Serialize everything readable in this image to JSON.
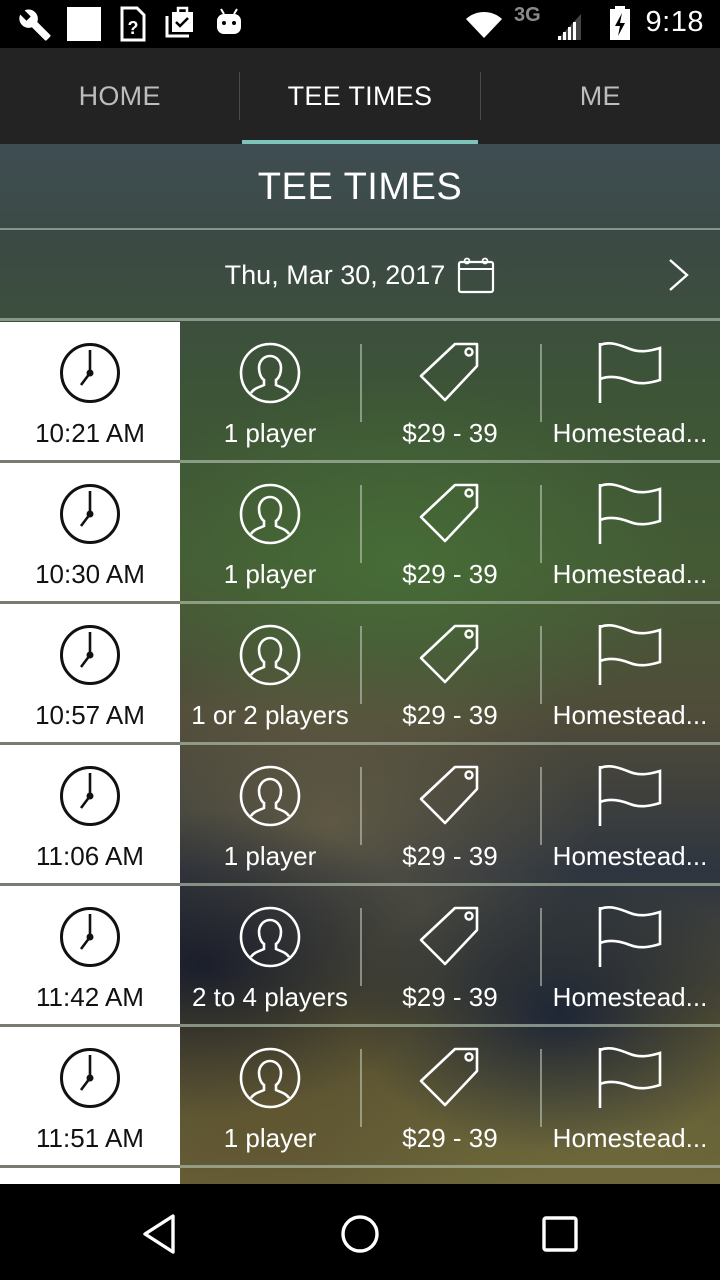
{
  "status_bar": {
    "left_icons": [
      "wrench-icon",
      "blank-square-icon",
      "sim-unknown-icon",
      "clipboard-check-icon",
      "android-icon"
    ],
    "right_icons": [
      "wifi-icon",
      "network-3g-icon",
      "signal-icon",
      "battery-charging-icon"
    ],
    "network_label": "3G",
    "time": "9:18"
  },
  "tabs": [
    {
      "label": "HOME",
      "active": false
    },
    {
      "label": "TEE TIMES",
      "active": true
    },
    {
      "label": "ME",
      "active": false
    }
  ],
  "accent_color": "#7fc4b8",
  "page": {
    "title": "TEE TIMES",
    "date": "Thu, Mar 30, 2017"
  },
  "tee_times": [
    {
      "time": "10:21 AM",
      "players": "1 player",
      "price": "$29 - 39",
      "course": "Homestead..."
    },
    {
      "time": "10:30 AM",
      "players": "1 player",
      "price": "$29 - 39",
      "course": "Homestead..."
    },
    {
      "time": "10:57 AM",
      "players": "1 or 2 players",
      "price": "$29 - 39",
      "course": "Homestead..."
    },
    {
      "time": "11:06 AM",
      "players": "1 player",
      "price": "$29 - 39",
      "course": "Homestead..."
    },
    {
      "time": "11:42 AM",
      "players": "2 to 4 players",
      "price": "$29 - 39",
      "course": "Homestead..."
    },
    {
      "time": "11:51 AM",
      "players": "1 player",
      "price": "$29 - 39",
      "course": "Homestead..."
    }
  ],
  "nav_bar": {
    "buttons": [
      "back-icon",
      "home-icon",
      "recents-icon"
    ]
  }
}
